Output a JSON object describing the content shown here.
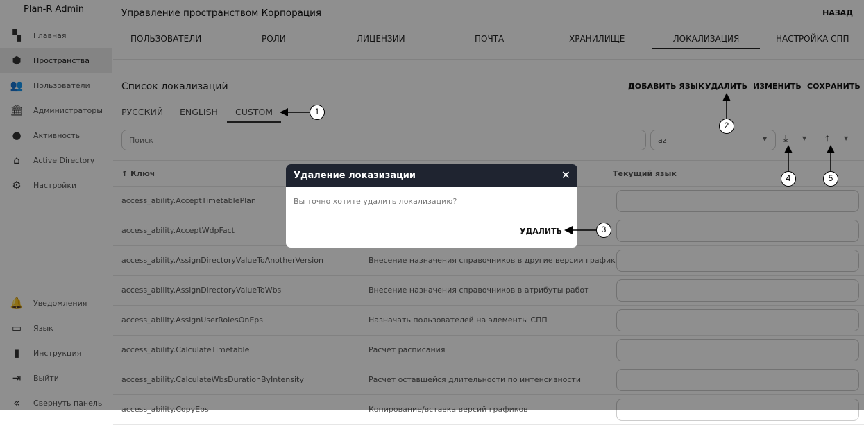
{
  "sidebar": {
    "logo": "Plan-R Admin",
    "items": [
      {
        "label": "Главная",
        "icon": "dashboard-icon",
        "glyph": "▚"
      },
      {
        "label": "Пространства",
        "icon": "cube-icon",
        "glyph": "⬢"
      },
      {
        "label": "Пользователи",
        "icon": "users-icon",
        "glyph": "👥"
      },
      {
        "label": "Администраторы",
        "icon": "building-icon",
        "glyph": "🏛"
      },
      {
        "label": "Активность",
        "icon": "clock-icon",
        "glyph": "●"
      },
      {
        "label": "Active Directory",
        "icon": "directory-icon",
        "glyph": "⌂"
      },
      {
        "label": "Настройки",
        "icon": "gear-icon",
        "glyph": "⚙"
      }
    ],
    "bottom": [
      {
        "label": "Уведомления",
        "icon": "bell-icon",
        "glyph": "🔔"
      },
      {
        "label": "Язык",
        "icon": "language-icon",
        "glyph": "▭"
      },
      {
        "label": "Инструкция",
        "icon": "book-icon",
        "glyph": "▮"
      },
      {
        "label": "Выйти",
        "icon": "logout-icon",
        "glyph": "⇥"
      },
      {
        "label": "Свернуть панель",
        "icon": "collapse-icon",
        "glyph": "«"
      }
    ]
  },
  "header": {
    "title": "Управление пространством Корпорация",
    "back": "НАЗАД"
  },
  "tabs": [
    "ПОЛЬЗОВАТЕЛИ",
    "РОЛИ",
    "ЛИЦЕНЗИИ",
    "ПОЧТА",
    "ХРАНИЛИЩЕ",
    "ЛОКАЛИЗАЦИЯ",
    "НАСТРОЙКА СПП"
  ],
  "section": {
    "title": "Список локализаций",
    "actions": [
      "ДОБАВИТЬ ЯЗЫК",
      "УДАЛИТЬ",
      "ИЗМЕНИТЬ",
      "СОХРАНИТЬ"
    ],
    "languages": [
      "РУССКИЙ",
      "ENGLISH",
      "CUSTOM"
    ]
  },
  "search": {
    "placeholder": "Поиск"
  },
  "select": {
    "value": "az"
  },
  "table": {
    "headers": [
      "↑ Ключ",
      "",
      "Текущий язык"
    ],
    "rows": [
      [
        "access_ability.AcceptTimetablePlan",
        ""
      ],
      [
        "access_ability.AcceptWdpFact",
        ""
      ],
      [
        "access_ability.AssignDirectoryValueToAnotherVersion",
        "Внесение назначения справочников в другие версии графиков"
      ],
      [
        "access_ability.AssignDirectoryValueToWbs",
        "Внесение назначения справочников в атрибуты работ"
      ],
      [
        "access_ability.AssignUserRolesOnEps",
        "Назначать пользователей на элементы СПП"
      ],
      [
        "access_ability.CalculateTimetable",
        "Расчет расписания"
      ],
      [
        "access_ability.CalculateWbsDurationByIntensity",
        "Расчет оставшейся длительности по интенсивности"
      ],
      [
        "access_ability.CopyEps",
        "Копирование/вставка версий графиков"
      ]
    ]
  },
  "modal": {
    "title": "Удаление локазизации",
    "message": "Вы точно хотите удалить локализацию?",
    "confirm": "УДАЛИТЬ"
  },
  "annotations": [
    "1",
    "2",
    "3",
    "4",
    "5"
  ]
}
